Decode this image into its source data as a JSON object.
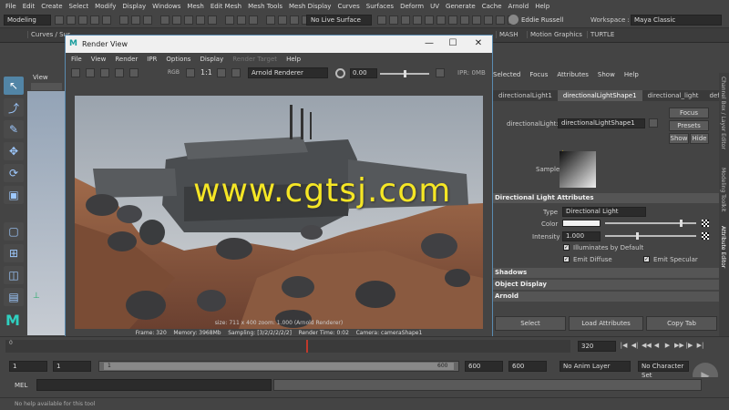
{
  "main_menu": [
    "File",
    "Edit",
    "Create",
    "Select",
    "Modify",
    "Display",
    "Windows",
    "Mesh",
    "Edit Mesh",
    "Mesh Tools",
    "Mesh Display",
    "Curves",
    "Surfaces",
    "Deform",
    "UV",
    "Generate",
    "Cache",
    "Arnold",
    "Help"
  ],
  "status_line": {
    "mode": "Modeling",
    "live_surface": "No Live Surface",
    "user": "Eddie Russell",
    "workspace_label": "Workspace :",
    "workspace": "Maya Classic"
  },
  "shelf": {
    "left_tab": "Curves / Sur",
    "tabs": [
      "MASH",
      "Motion Graphics",
      "TURTLE"
    ]
  },
  "viewport": {
    "menu_label": "View"
  },
  "render_view": {
    "title": "Render View",
    "window_controls": {
      "minimize": "—",
      "maximize": "☐",
      "close": "✕"
    },
    "menu": [
      "File",
      "View",
      "Render",
      "IPR",
      "Options",
      "Display",
      "Render Target",
      "Help"
    ],
    "ratio": "1:1",
    "renderer": "Arnold Renderer",
    "exposure": "0.00",
    "exposure_level": 0.5,
    "ipr": "IPR: 0MB",
    "size_info": "size: 711 x 400  zoom: 1.000     (Arnold Renderer)",
    "status": {
      "frame": "Frame: 320",
      "memory": "Memory: 3968Mb",
      "sampling": "Sampling: [3/2/2/2/2/2]",
      "render_time": "Render Time: 0:02",
      "camera": "Camera: cameraShape1"
    }
  },
  "watermark": "www.cgtsj.com",
  "attribute_editor": {
    "menu": [
      "Selected",
      "Focus",
      "Attributes",
      "Show",
      "Help"
    ],
    "tabs": [
      "directionalLight1",
      "directionalLightShape1",
      "directional_light",
      "defaultL"
    ],
    "active_tab": "directionalLightShape1",
    "node_label": "directionalLight:",
    "node_value": "directionalLightShape1",
    "buttons": {
      "focus": "Focus",
      "presets": "Presets",
      "show": "Show",
      "hide": "Hide"
    },
    "sample_label": "Sample",
    "sections": {
      "light_attributes": "Directional Light Attributes",
      "shadows": "Shadows",
      "object_display": "Object Display",
      "arnold": "Arnold"
    },
    "type_label": "Type",
    "type_value": "Directional Light",
    "color_label": "Color",
    "color_level": 0.83,
    "intensity_label": "Intensity",
    "intensity_value": "1.000",
    "intensity_level": 0.35,
    "checkboxes": [
      "Illuminates by Default",
      "Emit Diffuse",
      "Emit Specular"
    ],
    "bottom_buttons": {
      "select": "Select",
      "load": "Load Attributes",
      "copy": "Copy Tab"
    }
  },
  "side_tabs": [
    "Channel Box / Layer Editor",
    "Modeling Toolkit",
    "Attribute Editor"
  ],
  "timeline": {
    "ticks": [
      "0",
      "",
      "",
      "",
      "",
      "",
      "",
      "",
      "",
      "",
      "",
      "",
      "",
      "",
      "",
      "",
      "",
      "",
      "",
      "",
      "",
      "",
      "",
      "",
      "",
      "",
      "",
      "",
      "",
      "",
      "",
      "",
      "",
      "320",
      "",
      ""
    ],
    "current_frame": "320",
    "playback": [
      "|◀",
      "◀|",
      "◀◀",
      "◀",
      "▶",
      "▶▶",
      "|▶",
      "▶|"
    ]
  },
  "range": {
    "start": "1",
    "start2": "1",
    "slider_start": "1",
    "slider_end": "600",
    "end": "600",
    "end2": "600",
    "anim_layer": "No Anim Layer",
    "char_set": "No Character Set"
  },
  "command_line": {
    "label": "MEL"
  },
  "help_line": "No help available for this tool"
}
